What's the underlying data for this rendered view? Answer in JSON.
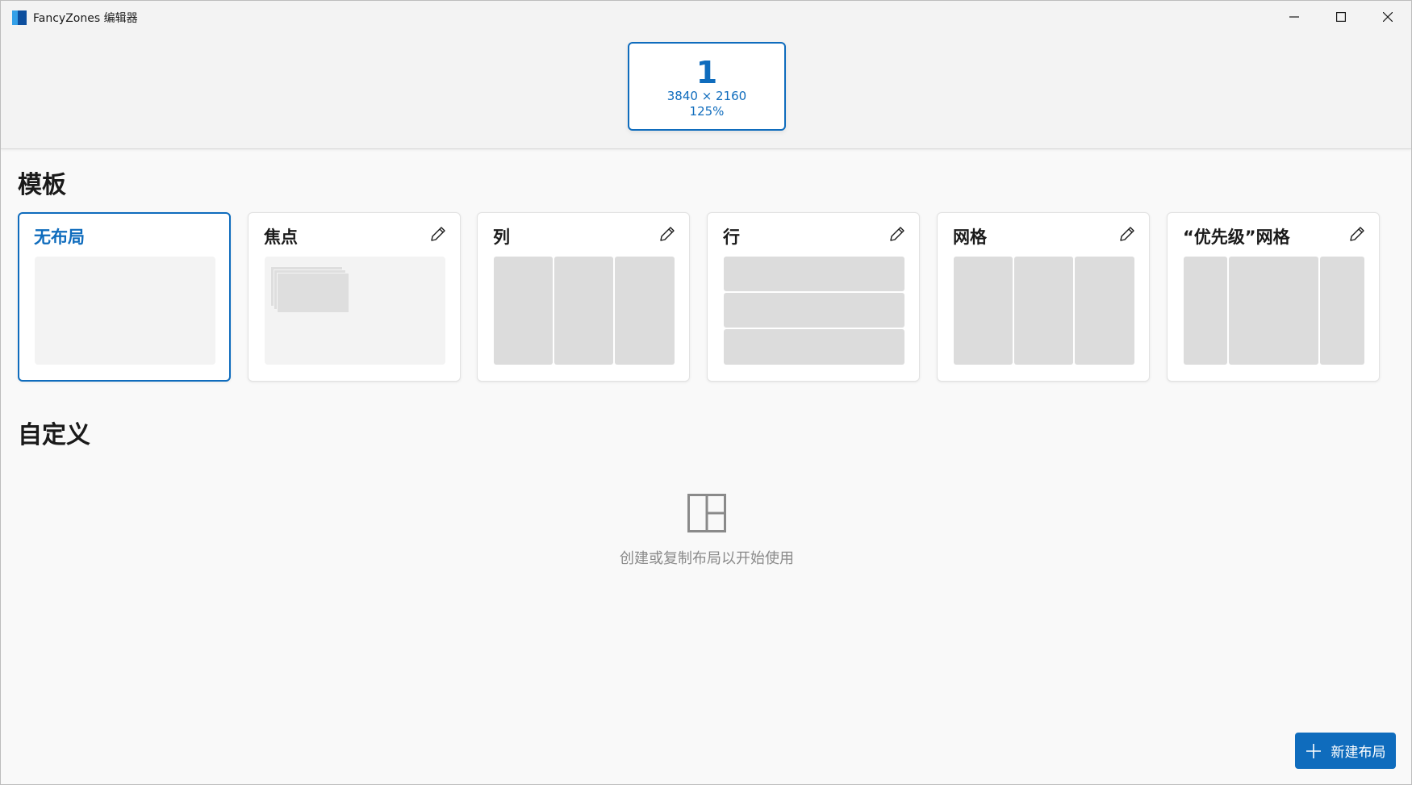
{
  "window": {
    "title": "FancyZones 编辑器"
  },
  "monitor": {
    "number": "1",
    "resolution": "3840 × 2160",
    "scale": "125%"
  },
  "sections": {
    "templates": "模板",
    "custom": "自定义"
  },
  "templates": [
    {
      "name": "无布局",
      "selected": true,
      "editable": false
    },
    {
      "name": "焦点",
      "selected": false,
      "editable": true
    },
    {
      "name": "列",
      "selected": false,
      "editable": true
    },
    {
      "name": "行",
      "selected": false,
      "editable": true
    },
    {
      "name": "网格",
      "selected": false,
      "editable": true
    },
    {
      "name": "“优先级”网格",
      "selected": false,
      "editable": true
    }
  ],
  "custom": {
    "empty_message": "创建或复制布局以开始使用"
  },
  "new_layout_button": "新建布局",
  "icons": {
    "app": "fancyzones-icon",
    "edit": "pencil-icon",
    "empty": "layout-icon",
    "add": "plus-icon"
  },
  "colors": {
    "accent": "#0f6cbd",
    "zone": "#dcdcdc",
    "background": "#f9f9f9"
  }
}
